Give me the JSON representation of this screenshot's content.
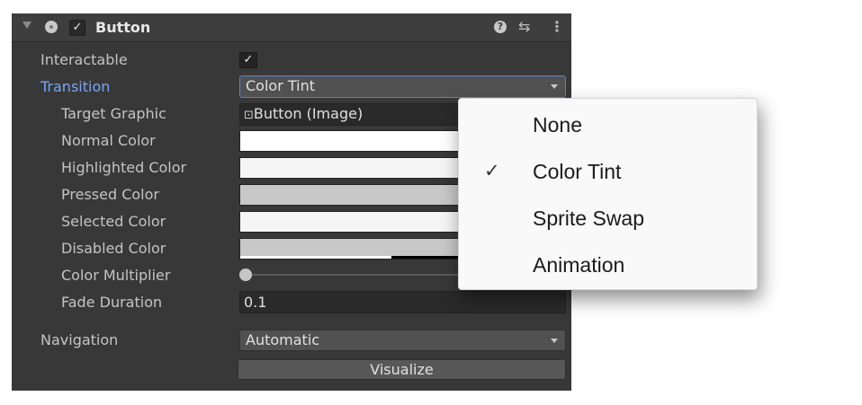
{
  "component": {
    "title": "Button",
    "enabled_check": "✓",
    "icons": {
      "fold": "triangle-down-icon",
      "radio": "gameobject-icon",
      "help": "?",
      "presets": "⇆",
      "menu": "⋮"
    }
  },
  "properties": {
    "interactable": {
      "label": "Interactable",
      "check": "✓"
    },
    "transition": {
      "label": "Transition",
      "value": "Color Tint"
    },
    "target_graphic": {
      "label": "Target Graphic",
      "icon": "⊡",
      "value": "Button (Image)"
    },
    "normal_color": {
      "label": "Normal Color",
      "color": "#ffffff"
    },
    "highlighted_color": {
      "label": "Highlighted Color",
      "color": "#f5f5f5"
    },
    "pressed_color": {
      "label": "Pressed Color",
      "color": "#c8c8c8"
    },
    "selected_color": {
      "label": "Selected Color",
      "color": "#f5f5f5"
    },
    "disabled_color": {
      "label": "Disabled Color",
      "color": "#c8c8c8",
      "alpha": 0.5
    },
    "color_multiplier": {
      "label": "Color Multiplier",
      "value_fraction": 0.0
    },
    "fade_duration": {
      "label": "Fade Duration",
      "value": "0.1"
    },
    "navigation": {
      "label": "Navigation",
      "value": "Automatic"
    },
    "visualize": {
      "label": "Visualize"
    }
  },
  "transition_menu": {
    "options": [
      {
        "label": "None",
        "checked": false
      },
      {
        "label": "Color Tint",
        "checked": true
      },
      {
        "label": "Sprite Swap",
        "checked": false
      },
      {
        "label": "Animation",
        "checked": false
      }
    ],
    "check_glyph": "✓"
  },
  "colors": {
    "panel": "#383838",
    "accent": "#7aa5f2",
    "focus": "#4d87d6"
  }
}
